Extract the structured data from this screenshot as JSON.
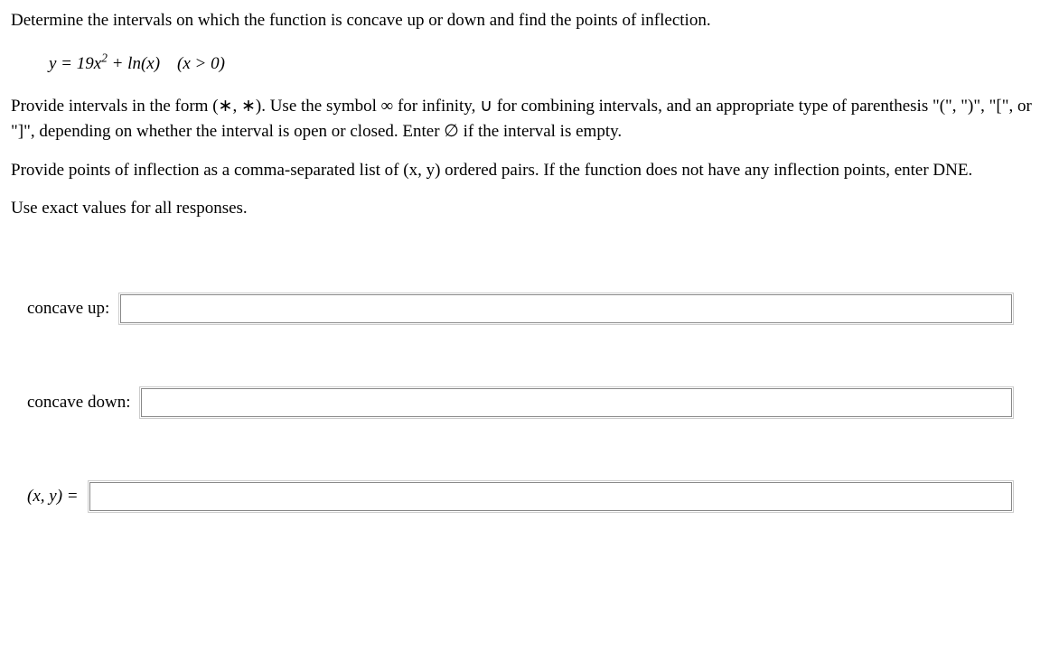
{
  "question": {
    "intro": "Determine the intervals on which the function is concave up or down and find the points of inflection.",
    "equation_prefix": "y = 19x",
    "equation_exp": "2",
    "equation_mid": " + ln(x)",
    "equation_domain": "(x > 0)",
    "instructions1": "Provide intervals in the form (∗, ∗). Use the symbol ∞ for infinity, ∪ for combining intervals, and an appropriate type of parenthesis \"(\", \")\", \"[\", or \"]\", depending on whether the interval is open or closed. Enter ∅ if the interval is empty.",
    "instructions2": "Provide points of inflection as a comma-separated list of (x, y) ordered pairs. If the function does not have any inflection points, enter DNE.",
    "instructions3": "Use exact values for all responses."
  },
  "inputs": {
    "concave_up_label": "concave up:",
    "concave_up_value": "",
    "concave_down_label": "concave down:",
    "concave_down_value": "",
    "xy_label": "(x, y) =",
    "xy_value": ""
  }
}
